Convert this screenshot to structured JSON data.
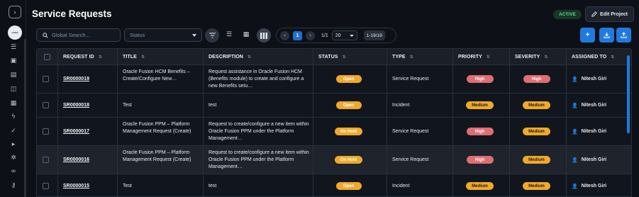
{
  "app": {
    "title": "Service Requests",
    "active_label": "ACTIVE",
    "edit_label": "Edit Project"
  },
  "toolbar": {
    "search_placeholder": "Global Search...",
    "status_placeholder": "Status",
    "page_current": "1",
    "page_of": "1/1",
    "page_size": "20",
    "range": "1-19/19"
  },
  "table": {
    "headers": [
      {
        "label": "",
        "sort": ""
      },
      {
        "label": "REQUEST ID",
        "sort": "⇅"
      },
      {
        "label": "TITLE",
        "sort": "⇅"
      },
      {
        "label": "DESCRIPTION",
        "sort": "⇅"
      },
      {
        "label": "STATUS",
        "sort": "⇅"
      },
      {
        "label": "TYPE",
        "sort": "⇅"
      },
      {
        "label": "PRIORITY",
        "sort": "⇅"
      },
      {
        "label": "SEVERITY",
        "sort": "⇅"
      },
      {
        "label": "ASSIGNED TO",
        "sort": "⇅"
      }
    ],
    "rows": [
      {
        "id": "SR0000019",
        "title": "Oracle Fusion HCM Benefits – Create/Configure New…",
        "description": "Request assistance in Oracle Fusion HCM (Benefits module) to create and configure a new Benefits setu…",
        "status": "Open",
        "type": "Service Request",
        "priority": "High",
        "severity": "High",
        "assigned": "Nitesh Giri"
      },
      {
        "id": "SR0000018",
        "title": "Test",
        "description": "test",
        "status": "Open",
        "type": "Incident",
        "priority": "Medium",
        "severity": "Medium",
        "assigned": "Nitesh Giri"
      },
      {
        "id": "SR0000017",
        "title": "Oracle Fusion PPM – Platform Management Request (Create)",
        "description": "Request to create/configure a new item within Oracle Fusion PPM under the Platform Management…",
        "status": "On Hold",
        "type": "Service Request",
        "priority": "High",
        "severity": "Medium",
        "assigned": "Nitesh Giri"
      },
      {
        "id": "SR0000016",
        "title": "Oracle Fusion PPM – Platform Management Request (Create)",
        "description": "Request to create/configure a new item within Oracle Fusion PPM under the Platform Management…",
        "status": "On Hold",
        "type": "Service Request",
        "priority": "High",
        "severity": "Medium",
        "assigned": "Nitesh Giri"
      },
      {
        "id": "SR0000015",
        "title": "Test",
        "description": "test",
        "status": "Open",
        "type": "Incident",
        "priority": "Medium",
        "severity": "Medium",
        "assigned": "Nitesh Giri"
      }
    ]
  },
  "colors": {
    "accent": "#1f7ae0",
    "status_open": "#f0a92a",
    "priority_high": "#e06d73",
    "active_green": "#5fd38d"
  }
}
